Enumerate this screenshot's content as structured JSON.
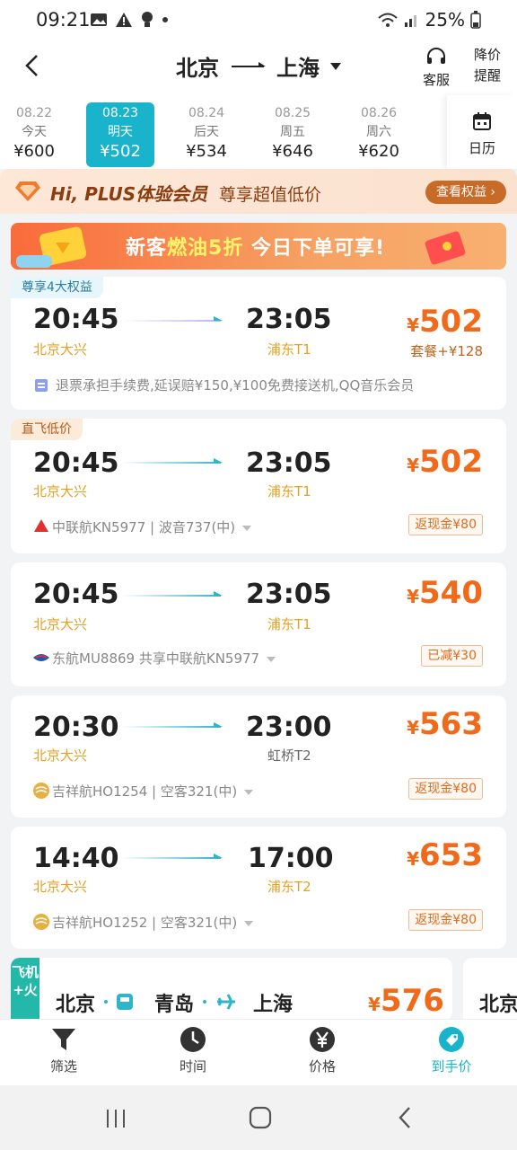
{
  "status": {
    "time": "09:21",
    "battery": "25%"
  },
  "header": {
    "from": "北京",
    "to": "上海",
    "kefu": "客服",
    "alert_line1": "降价",
    "alert_line2": "提醒"
  },
  "dates": [
    {
      "date": "08.22",
      "weekday": "今天",
      "price": "¥600"
    },
    {
      "date": "08.23",
      "weekday": "明天",
      "price": "¥502"
    },
    {
      "date": "08.24",
      "weekday": "后天",
      "price": "¥534"
    },
    {
      "date": "08.25",
      "weekday": "周五",
      "price": "¥646"
    },
    {
      "date": "08.26",
      "weekday": "周六",
      "price": "¥620"
    }
  ],
  "calendar_label": "日历",
  "plus": {
    "title": "Hi, PLUS体验会员",
    "subtitle": "尊享超值低价",
    "button": "查看权益 ›"
  },
  "promo": {
    "part1": "新客",
    "highlight": "燃油5折",
    "part2": " 今日下单可享!"
  },
  "flights": [
    {
      "tag": "尊享4大权益",
      "dep_time": "20:45",
      "dep_airport": "北京大兴",
      "arr_time": "23:05",
      "arr_airport": "浦东T1",
      "price_symbol": "¥",
      "price": "502",
      "extra": "套餐+¥128",
      "info": "退票承担手续费,延误赔¥150,¥100免费接送机,QQ音乐会员",
      "badge": ""
    },
    {
      "tag": "直飞低价",
      "dep_time": "20:45",
      "dep_airport": "北京大兴",
      "arr_time": "23:05",
      "arr_airport": "浦东T1",
      "price_symbol": "¥",
      "price": "502",
      "info": "中联航KN5977 | 波音737(中)",
      "badge": "返现金¥80"
    },
    {
      "dep_time": "20:45",
      "dep_airport": "北京大兴",
      "arr_time": "23:05",
      "arr_airport": "浦东T1",
      "price_symbol": "¥",
      "price": "540",
      "info": "东航MU8869 共享中联航KN5977",
      "badge": "已减¥30"
    },
    {
      "dep_time": "20:30",
      "dep_airport": "北京大兴",
      "arr_time": "23:00",
      "arr_airport": "虹桥T2",
      "price_symbol": "¥",
      "price": "563",
      "info": "吉祥航HO1254 | 空客321(中)",
      "badge": "返现金¥80"
    },
    {
      "dep_time": "14:40",
      "dep_airport": "北京大兴",
      "arr_time": "17:00",
      "arr_airport": "浦东T2",
      "price_symbol": "¥",
      "price": "653",
      "info": "吉祥航HO1252 | 空客321(中)",
      "badge": "返现金¥80"
    }
  ],
  "transfer": {
    "tag": "飞机+火",
    "stop1": "北京",
    "stop2": "青岛",
    "stop3": "上海",
    "price_symbol": "¥",
    "price": "576",
    "peek": "北京"
  },
  "bottom": {
    "filter": "筛选",
    "time": "时间",
    "price": "价格",
    "final": "到手价"
  },
  "colors": {
    "accent": "#19b4cb",
    "price": "#f06a1a",
    "airport": "#e8a020"
  }
}
